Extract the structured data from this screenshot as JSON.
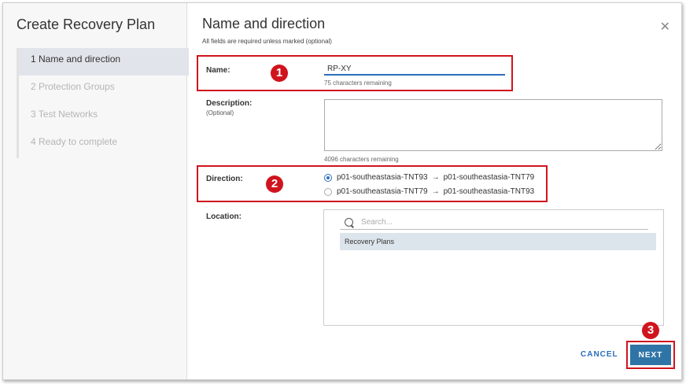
{
  "wizard": {
    "title": "Create Recovery Plan",
    "steps": [
      {
        "label": "1  Name and direction",
        "active": true
      },
      {
        "label": "2  Protection Groups",
        "active": false
      },
      {
        "label": "3  Test Networks",
        "active": false
      },
      {
        "label": "4  Ready to complete",
        "active": false
      }
    ]
  },
  "page": {
    "title": "Name and direction",
    "subtitle": "All fields are required unless marked (optional)",
    "close_icon": "close-icon"
  },
  "form": {
    "name": {
      "label": "Name:",
      "value": "RP-XY",
      "hint": "75 characters remaining"
    },
    "description": {
      "label": "Description:",
      "sublabel": "(Optional)",
      "value": "",
      "hint": "4096 characters remaining"
    },
    "direction": {
      "label": "Direction:",
      "options": [
        {
          "from": "p01-southeastasia-TNT93",
          "arrow": "→",
          "to": "p01-southeastasia-TNT79",
          "selected": true
        },
        {
          "from": "p01-southeastasia-TNT79",
          "arrow": "→",
          "to": "p01-southeastasia-TNT93",
          "selected": false
        }
      ]
    },
    "location": {
      "label": "Location:",
      "search_placeholder": "Search...",
      "items": [
        "Recovery Plans"
      ]
    }
  },
  "annotations": {
    "badge1": "1",
    "badge2": "2",
    "badge3": "3",
    "color": "#d0141e"
  },
  "footer": {
    "cancel_label": "CANCEL",
    "next_label": "NEXT"
  },
  "colors": {
    "accent": "#2a6ebb",
    "primary_button": "#2f74a6"
  }
}
